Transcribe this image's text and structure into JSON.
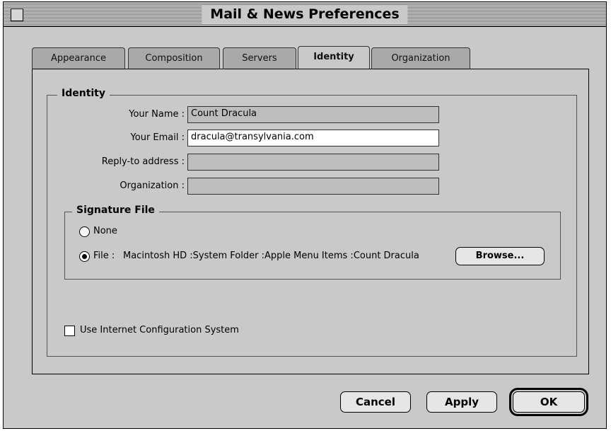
{
  "window": {
    "title": "Mail & News Preferences"
  },
  "tabs": [
    {
      "label": "Appearance",
      "active": false
    },
    {
      "label": "Composition",
      "active": false
    },
    {
      "label": "Servers",
      "active": false
    },
    {
      "label": "Identity",
      "active": true
    },
    {
      "label": "Organization",
      "active": false
    }
  ],
  "identity": {
    "legend": "Identity",
    "name_label": "Your Name :",
    "name_value": "Count Dracula",
    "email_label": "Your Email :",
    "email_value": "dracula@transylvania.com",
    "reply_label": "Reply-to address :",
    "reply_value": "",
    "org_label": "Organization :",
    "org_value": ""
  },
  "signature": {
    "legend": "Signature File",
    "none_label": "None",
    "file_label": "File :",
    "file_path": "Macintosh HD :System Folder :Apple Menu Items :Count Dracula",
    "selected": "file",
    "browse_label": "Browse..."
  },
  "ics": {
    "label": "Use Internet Configuration System",
    "checked": false
  },
  "buttons": {
    "cancel": "Cancel",
    "apply": "Apply",
    "ok": "OK"
  }
}
